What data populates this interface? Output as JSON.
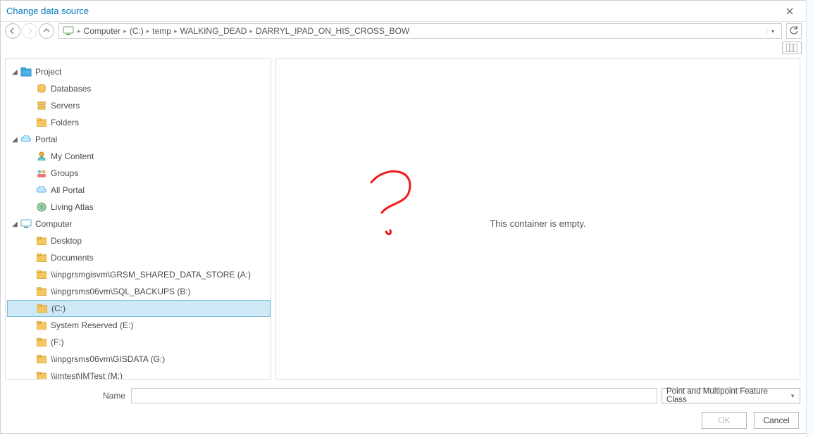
{
  "title": "Change data source",
  "breadcrumbs": [
    "Computer",
    "(C:)",
    "temp",
    "WALKING_DEAD",
    "DARRYL_IPAD_ON_HIS_CROSS_BOW"
  ],
  "tree": {
    "project": {
      "label": "Project",
      "children": [
        "Databases",
        "Servers",
        "Folders"
      ]
    },
    "portal": {
      "label": "Portal",
      "children": [
        "My Content",
        "Groups",
        "All Portal",
        "Living Atlas"
      ]
    },
    "computer": {
      "label": "Computer",
      "children": [
        "Desktop",
        "Documents",
        "\\\\inpgrsmgisvm\\GRSM_SHARED_DATA_STORE (A:)",
        "\\\\inpgrsms06vm\\SQL_BACKUPS (B:)",
        "(C:)",
        "System Reserved (E:)",
        "(F:)",
        "\\\\inpgrsms06vm\\GISDATA (G:)",
        "\\\\imtest\\IMTest (M:)"
      ],
      "selected": "(C:)"
    }
  },
  "content": {
    "empty_message": "This container is empty."
  },
  "footer": {
    "name_label": "Name",
    "name_value": "",
    "type_label": "Point and Multipoint Feature Class",
    "ok_label": "OK",
    "cancel_label": "Cancel"
  }
}
